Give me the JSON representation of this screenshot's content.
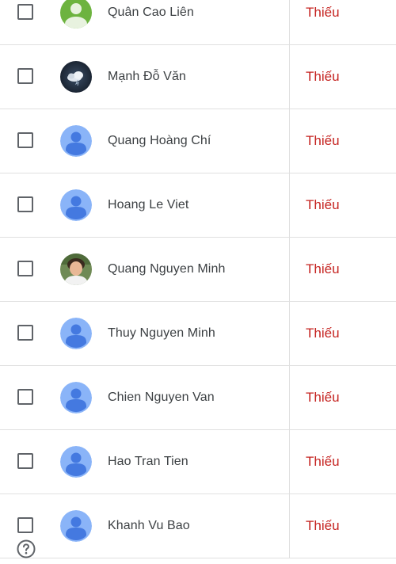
{
  "students": [
    {
      "name": "Quân Cao Liên",
      "status": "Thiếu",
      "avatar": "photo-green-avatar"
    },
    {
      "name": "Mạnh Đỗ Văn",
      "status": "Thiếu",
      "avatar": "photo-cloud-avatar"
    },
    {
      "name": "Quang Hoàng Chí",
      "status": "Thiếu",
      "avatar": "default-person-avatar"
    },
    {
      "name": "Hoang Le Viet",
      "status": "Thiếu",
      "avatar": "default-person-avatar"
    },
    {
      "name": "Quang Nguyen Minh",
      "status": "Thiếu",
      "avatar": "photo-person-avatar"
    },
    {
      "name": "Thuy Nguyen Minh",
      "status": "Thiếu",
      "avatar": "default-person-avatar"
    },
    {
      "name": "Chien Nguyen Van",
      "status": "Thiếu",
      "avatar": "default-person-avatar"
    },
    {
      "name": "Hao Tran Tien",
      "status": "Thiếu",
      "avatar": "default-person-avatar"
    },
    {
      "name": "Khanh Vu Bao",
      "status": "Thiếu",
      "avatar": "default-person-avatar"
    }
  ],
  "colors": {
    "status_missing": "#c5221f",
    "avatar_default_bg": "#8ab4f8",
    "avatar_default_fg": "#4479e0",
    "divider": "#e0e0e0"
  },
  "help_icon": "help-circle-icon"
}
